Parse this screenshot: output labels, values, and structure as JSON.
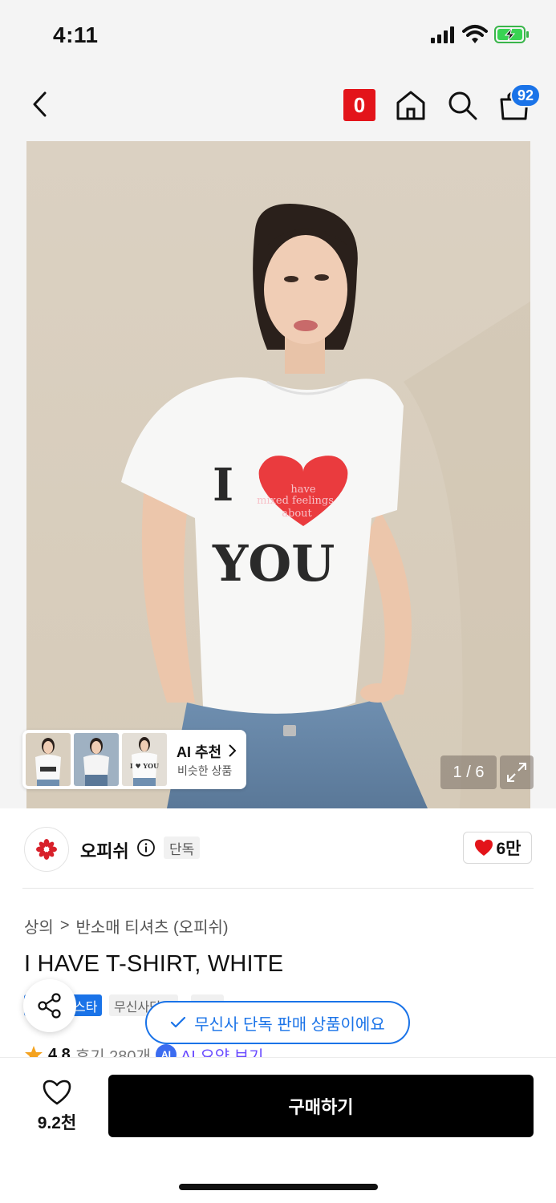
{
  "status_bar": {
    "time": "4:11"
  },
  "nav": {
    "brand_badge": "0",
    "cart_count": "92"
  },
  "hero": {
    "shirt_line1": "I",
    "shirt_heart_text": [
      "have",
      "mixed feelings",
      "about"
    ],
    "shirt_line2": "YOU",
    "counter": "1 / 6",
    "ai_recommend_title": "AI 추천",
    "ai_recommend_sub": "비슷한 상품",
    "thumb3_text": "I ♥ YOU"
  },
  "brand": {
    "name": "오피쉬",
    "exclusive_label": "단독",
    "likes": "6만"
  },
  "breadcrumb": {
    "category": "상의",
    "separator": ">",
    "subcategory": "반소매 티셔츠 (오피쉬)"
  },
  "product": {
    "title": "I HAVE T-SHIRT, WHITE"
  },
  "tags": {
    "blue": "스타",
    "grey1": "무신사단독",
    "grey2": "쿠폰"
  },
  "rating": {
    "score": "4.8",
    "reviews": "후기 280개",
    "ai_badge": "AI",
    "ai_summary": "AI 요약 보기"
  },
  "toast": {
    "text": "무신사 단독 판매 상품이에요"
  },
  "bottom": {
    "wish_count": "9.2천",
    "buy_label": "구매하기"
  },
  "colors": {
    "accent": "#1a73e8",
    "brand_red": "#e3141a",
    "buy_button": "#000000"
  }
}
